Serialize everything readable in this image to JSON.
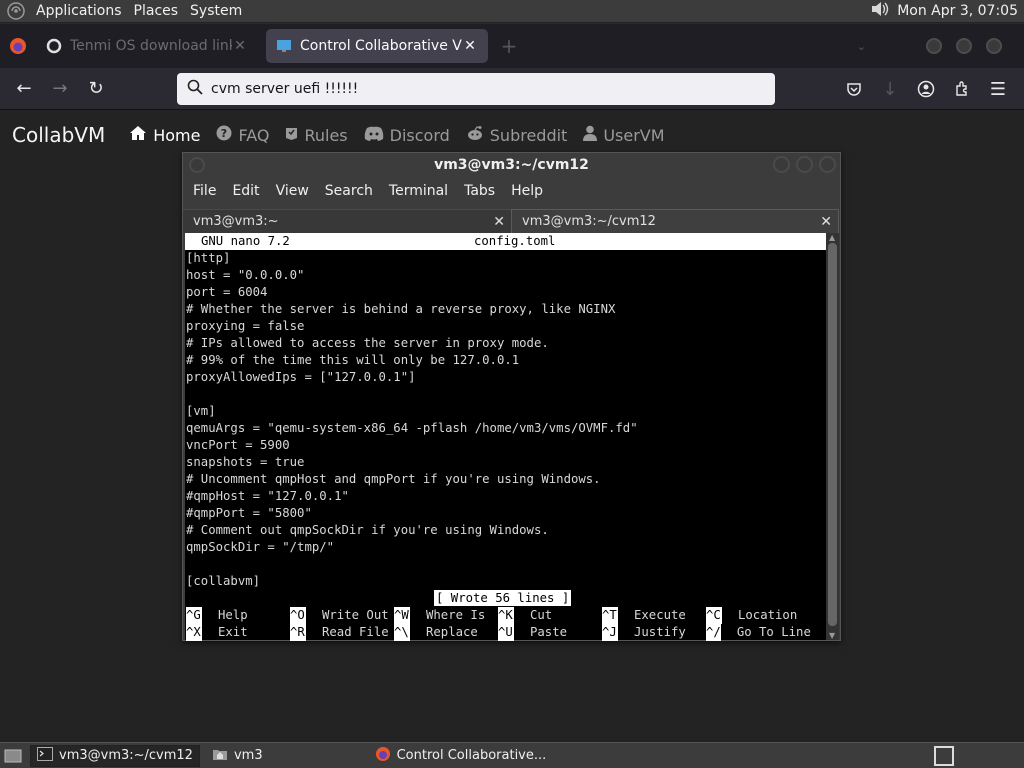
{
  "top_panel": {
    "menus": [
      "Applications",
      "Places",
      "System"
    ],
    "clock": "Mon Apr  3, 07:05"
  },
  "browser": {
    "tabs": [
      {
        "title": "Tenmi OS download links",
        "active": false
      },
      {
        "title": "Control Collaborative Virtual",
        "active": true
      }
    ],
    "new_tab": "+",
    "url": "cvm server uefi !!!!!!"
  },
  "site": {
    "brand": "CollabVM",
    "nav": [
      {
        "label": "Home",
        "icon": "home-icon",
        "active": true
      },
      {
        "label": "FAQ",
        "icon": "question-icon",
        "active": false
      },
      {
        "label": "Rules",
        "icon": "rules-icon",
        "active": false
      },
      {
        "label": "Discord",
        "icon": "discord-icon",
        "active": false
      },
      {
        "label": "Subreddit",
        "icon": "reddit-icon",
        "active": false
      },
      {
        "label": "UserVM",
        "icon": "user-icon",
        "active": false
      }
    ]
  },
  "terminal": {
    "title": "vm3@vm3:~/cvm12",
    "menu": [
      "File",
      "Edit",
      "View",
      "Search",
      "Terminal",
      "Tabs",
      "Help"
    ],
    "tabs": [
      {
        "title": "vm3@vm3:~",
        "active": false
      },
      {
        "title": "vm3@vm3:~/cvm12",
        "active": true
      }
    ],
    "nano": {
      "version": "GNU nano 7.2",
      "filename": "config.toml",
      "lines": [
        "[http]",
        "host = \"0.0.0.0\"",
        "port = 6004",
        "# Whether the server is behind a reverse proxy, like NGINX",
        "proxying = false",
        "# IPs allowed to access the server in proxy mode.",
        "# 99% of the time this will only be 127.0.0.1",
        "proxyAllowedIps = [\"127.0.0.1\"]",
        "",
        "[vm]",
        "qemuArgs = \"qemu-system-x86_64 -pflash /home/vm3/vms/OVMF.fd\"",
        "vncPort = 5900",
        "snapshots = true",
        "# Uncomment qmpHost and qmpPort if you're using Windows.",
        "#qmpHost = \"127.0.0.1\"",
        "#qmpPort = \"5800\"",
        "# Comment out qmpSockDir if you're using Windows.",
        "qmpSockDir = \"/tmp/\"",
        "",
        "[collabvm]"
      ],
      "status_message": "[ Wrote 56 lines ]",
      "shortcuts_row1": [
        {
          "key": "^G",
          "label": "Help"
        },
        {
          "key": "^O",
          "label": "Write Out"
        },
        {
          "key": "^W",
          "label": "Where Is"
        },
        {
          "key": "^K",
          "label": "Cut"
        },
        {
          "key": "^T",
          "label": "Execute"
        },
        {
          "key": "^C",
          "label": "Location"
        }
      ],
      "shortcuts_row2": [
        {
          "key": "^X",
          "label": "Exit"
        },
        {
          "key": "^R",
          "label": "Read File"
        },
        {
          "key": "^\\",
          "label": "Replace"
        },
        {
          "key": "^U",
          "label": "Paste"
        },
        {
          "key": "^J",
          "label": "Justify"
        },
        {
          "key": "^/",
          "label": "Go To Line"
        }
      ]
    }
  },
  "taskbar": {
    "items": [
      {
        "label": "vm3@vm3:~/cvm12",
        "icon": "terminal-icon",
        "active": true
      },
      {
        "label": "vm3",
        "icon": "folder-icon",
        "active": false
      },
      {
        "label": "Control Collaborative...",
        "icon": "firefox-icon",
        "active": false
      }
    ]
  }
}
